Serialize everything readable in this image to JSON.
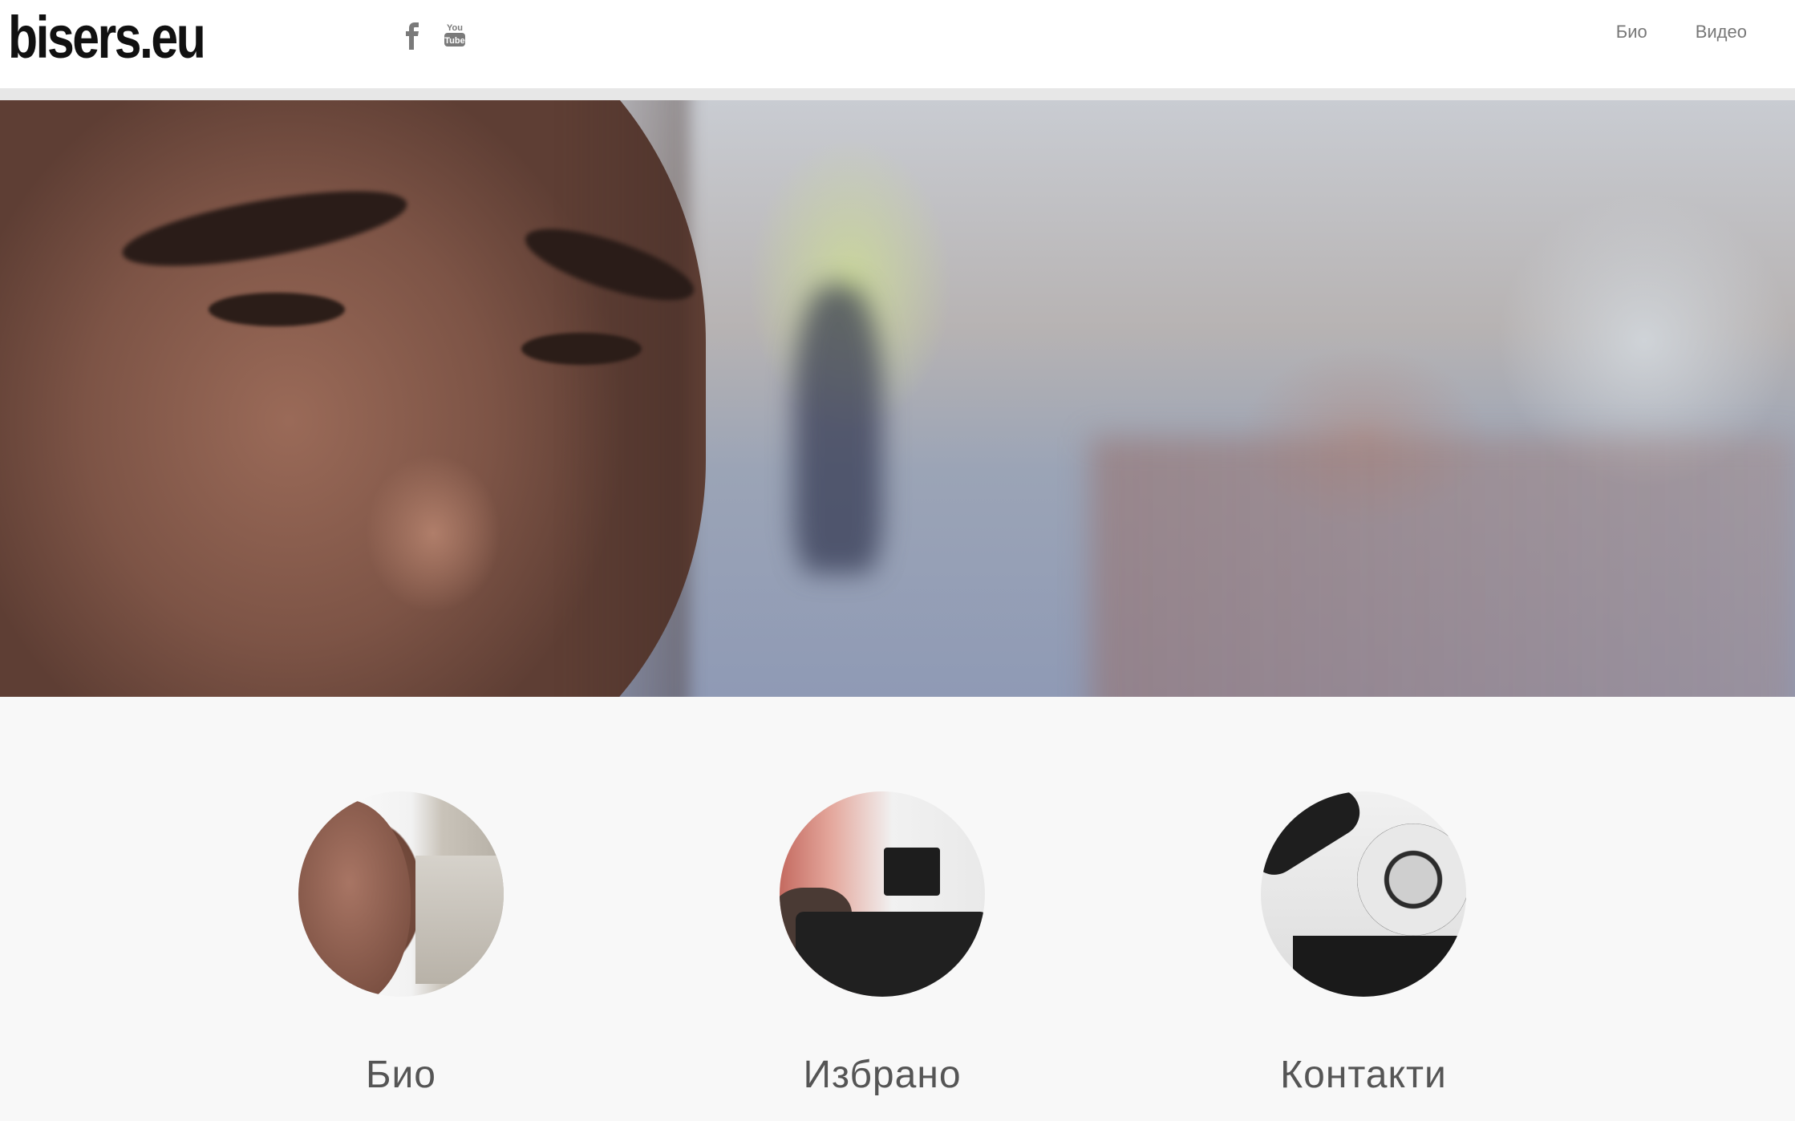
{
  "site": {
    "logo_text": "bisers.eu"
  },
  "social": [
    {
      "icon": "facebook-icon"
    },
    {
      "icon": "youtube-icon"
    }
  ],
  "nav": {
    "items": [
      {
        "label": "Био"
      },
      {
        "label": "Видео"
      }
    ]
  },
  "features": [
    {
      "title": "Био",
      "image": "portrait-thumbnail"
    },
    {
      "title": "Избрано",
      "image": "camera-thumbnail"
    },
    {
      "title": "Контакти",
      "image": "rotary-phone-thumbnail"
    }
  ],
  "colors": {
    "header_bg": "#ffffff",
    "header_border": "#e7e7e7",
    "page_bg": "#f8f8f8",
    "nav_text": "#777777",
    "feature_title": "#555555",
    "logo": "#111111"
  }
}
